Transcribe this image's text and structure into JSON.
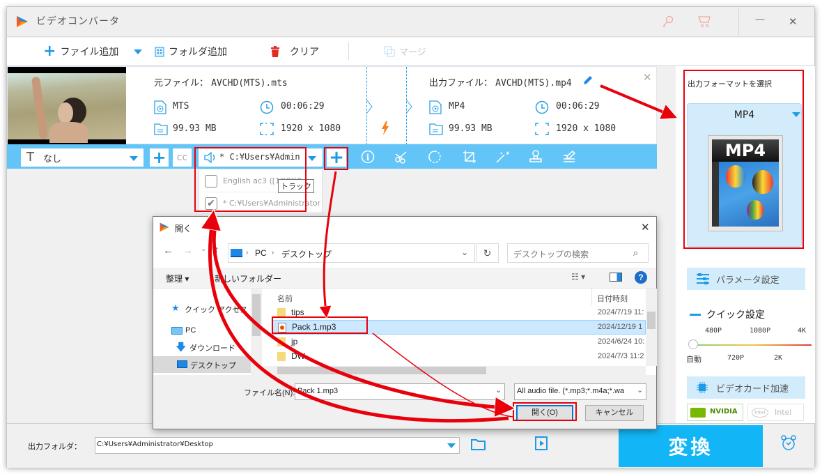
{
  "app": {
    "title": "ビデオコンバータ",
    "window_buttons": {
      "minimize": "—",
      "close": "✕"
    },
    "title_icons": [
      "key-icon",
      "cart-icon"
    ]
  },
  "toolbar": {
    "add_file": "ファイル追加",
    "add_folder": "フォルダ追加",
    "clear": "クリア",
    "merge": "マージ"
  },
  "file_item": {
    "source_label": "元ファイル：",
    "source_name": "AVCHD(MTS).mts",
    "source_format": "MTS",
    "source_duration": "00:06:29",
    "source_size": "99.93 MB",
    "source_resolution": "1920 x 1080",
    "output_label": "出力ファイル：",
    "output_name": "AVCHD(MTS).mp4",
    "output_format": "MP4",
    "output_duration": "00:06:29",
    "output_size": "99.93 MB",
    "output_resolution": "1920 x 1080"
  },
  "edit_bar": {
    "subtitle_value": "なし",
    "audio_value": "* C:¥Users¥Admin",
    "audio_options": [
      {
        "label": "English ac3 ([1][0][0",
        "checked": false
      },
      {
        "label": "* C:¥Users¥Administrator¥",
        "checked": true
      }
    ],
    "tooltip": "トラック"
  },
  "right_panel": {
    "format_heading": "出力フォーマットを選択",
    "format_value": "MP4",
    "format_thumb_label": "MP4",
    "param_button": "パラメータ設定",
    "quick_heading": "クイック設定",
    "quick_ticks_top": [
      "480P",
      "1080P",
      "4K"
    ],
    "quick_ticks_bottom": [
      "自動",
      "720P",
      "2K"
    ],
    "quick_value": "自動",
    "gpu_button": "ビデオカード加速",
    "nvidia": "NVIDIA",
    "intel": "Intel"
  },
  "bottom": {
    "output_folder_label": "出力フォルダ：",
    "output_folder_value": "C:¥Users¥Administrator¥Desktop",
    "convert_button": "変換"
  },
  "dialog": {
    "title": "開く",
    "breadcrumb": [
      "PC",
      "デスクトップ"
    ],
    "search_placeholder": "デスクトップの検索",
    "organize": "整理 ▾",
    "new_folder": "新しいフォルダー",
    "sidebar": [
      {
        "label": "クイック アクセス",
        "icon": "star-icon"
      },
      {
        "label": "PC",
        "icon": "pc-icon"
      },
      {
        "label": "ダウンロード",
        "icon": "download-icon"
      },
      {
        "label": "デスクトップ",
        "icon": "desktop-icon",
        "selected": true
      }
    ],
    "columns": {
      "name": "名前",
      "date": "日付時刻"
    },
    "files": [
      {
        "name": "tips",
        "date": "2024/7/19 11:",
        "type": "folder-shortcut"
      },
      {
        "name": "Pack 1.mp3",
        "date": "2024/12/19 1",
        "type": "audio",
        "selected": true
      },
      {
        "name": "jp",
        "date": "2024/6/24 10:",
        "type": "folder-shortcut"
      },
      {
        "name": "DW",
        "date": "2024/7/3 11:2",
        "type": "folder"
      }
    ],
    "filename_label": "ファイル名(N):",
    "filename_value": "Pack 1.mp3",
    "filetype_value": "All audio file. (*.mp3;*.m4a;*.wa",
    "open_button": "開く(O)",
    "cancel_button": "キャンセル"
  },
  "colors": {
    "accent": "#12b6f6",
    "edit_bar": "#63c4f8",
    "highlight": "#e8000b",
    "selected_row": "#cce8ff"
  }
}
